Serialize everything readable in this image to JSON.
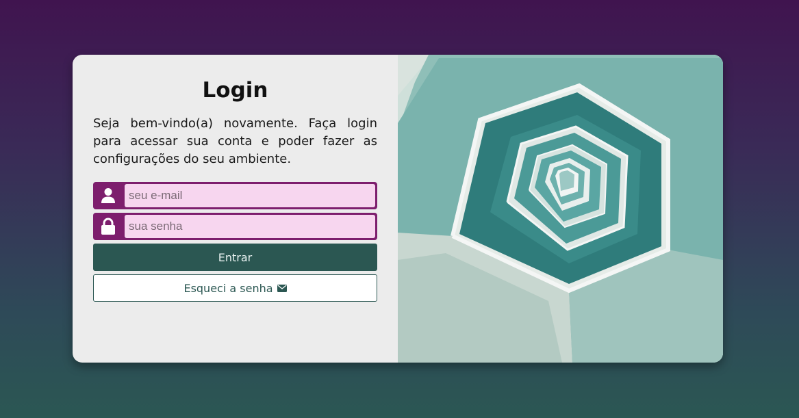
{
  "login": {
    "title": "Login",
    "welcome_text": "Seja bem-vindo(a) novamente. Faça login para acessar sua conta e poder fazer as configurações do seu ambiente.",
    "email": {
      "placeholder": "seu e-mail",
      "value": "",
      "icon": "user-icon"
    },
    "password": {
      "placeholder": "sua senha",
      "value": "",
      "icon": "lock-icon"
    },
    "submit_label": "Entrar",
    "forgot_label": "Esqueci a senha",
    "forgot_icon": "envelope-icon"
  },
  "colors": {
    "accent": "#7d1e6d",
    "input_bg": "#f7d6ef",
    "primary_button": "#2b5752",
    "card_bg": "#ececec"
  },
  "image": {
    "subject": "spiral-staircase-photo"
  }
}
